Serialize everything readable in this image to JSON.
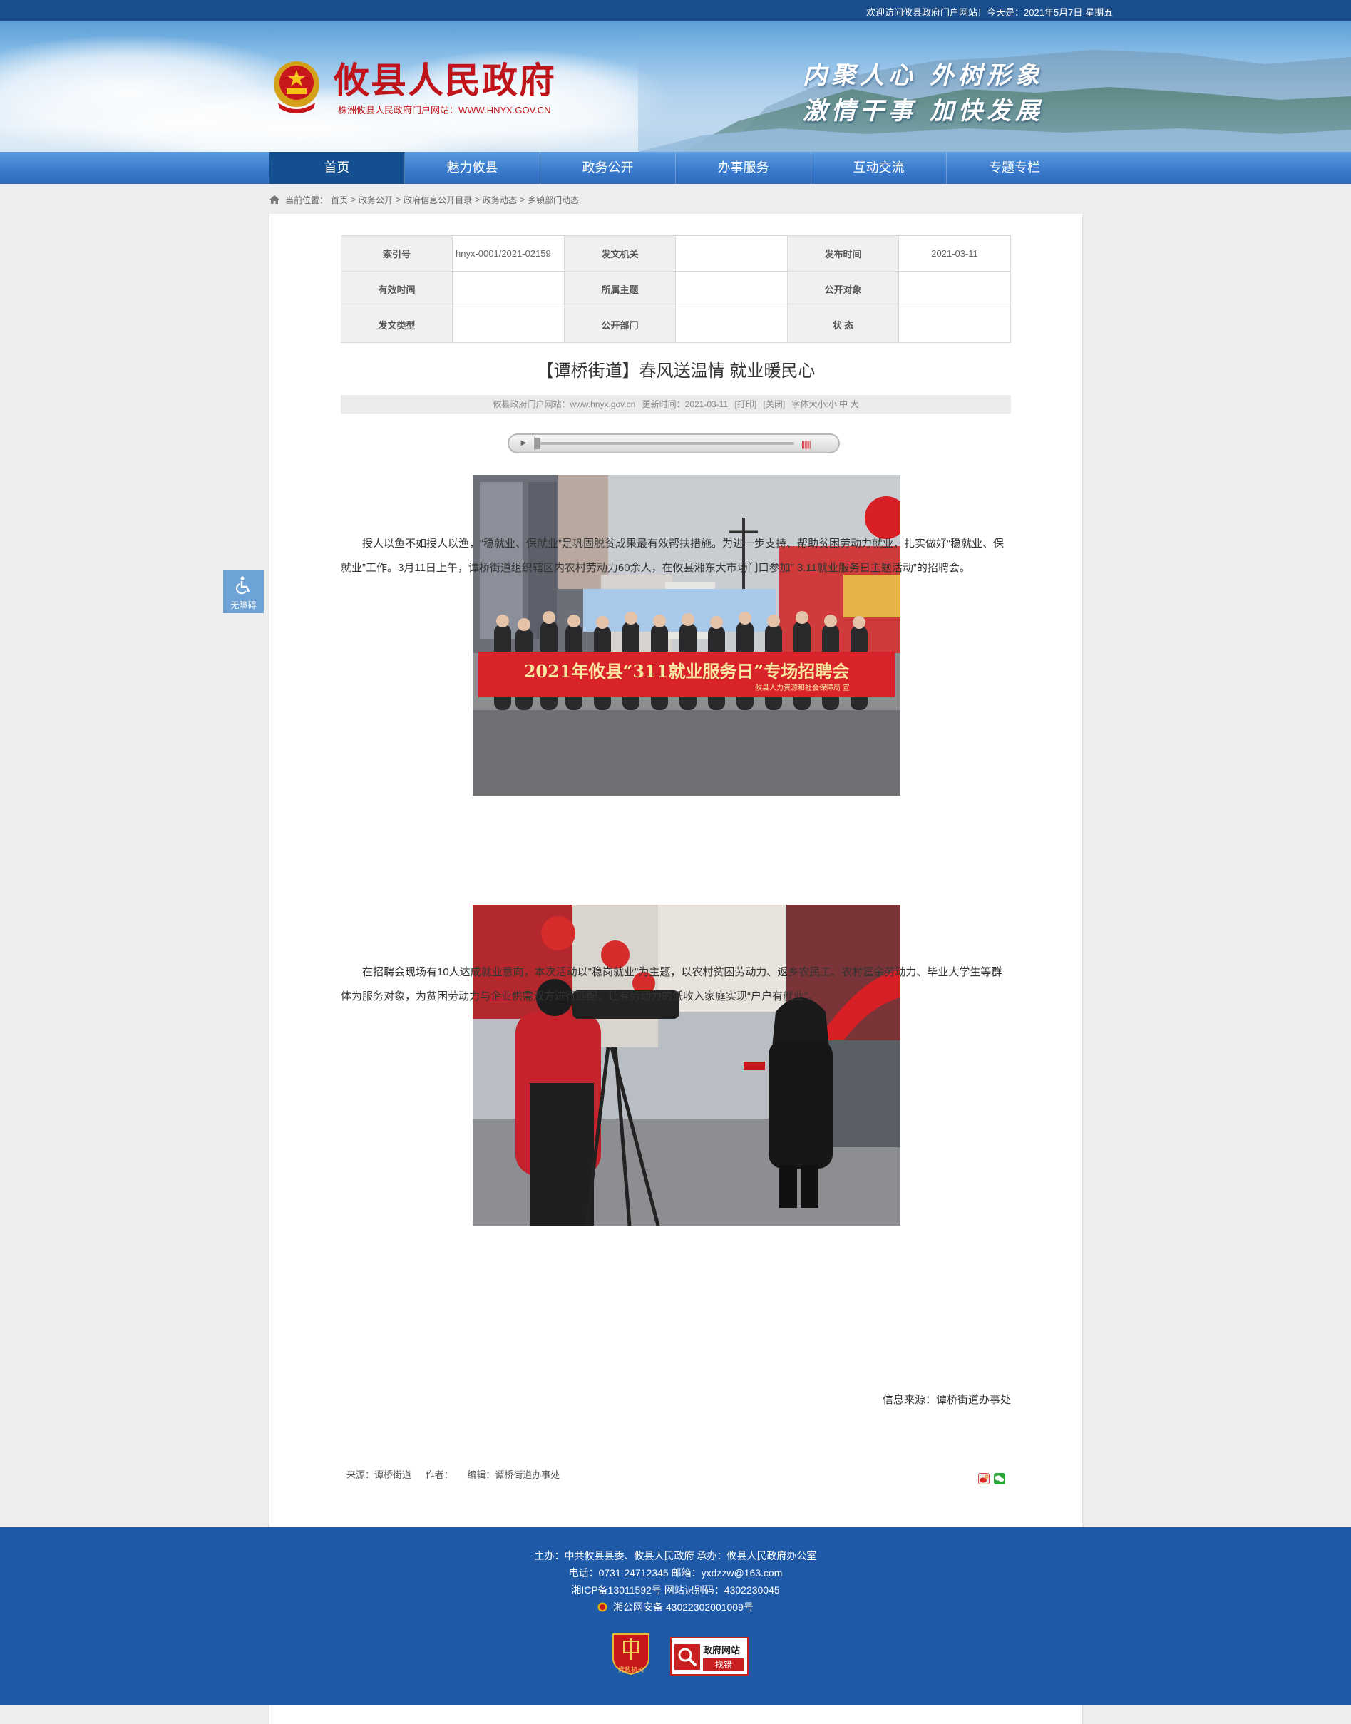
{
  "topbar": {
    "welcome": "欢迎访问攸县政府门户网站！今天是：2021年5月7日 星期五"
  },
  "header": {
    "site_name": "攸县人民政府",
    "site_subtitle": "株洲攸县人民政府门户网站：WWW.HNYX.GOV.CN",
    "slogan_line1": "内聚人心 外树形象",
    "slogan_line2": "激情干事 加快发展"
  },
  "nav": {
    "items": [
      {
        "label": "首页"
      },
      {
        "label": "魅力攸县"
      },
      {
        "label": "政务公开"
      },
      {
        "label": "办事服务"
      },
      {
        "label": "互动交流"
      },
      {
        "label": "专题专栏"
      }
    ]
  },
  "breadcrumb": {
    "prefix": "当前位置：",
    "items": [
      "首页",
      "政务公开",
      "政府信息公开目录",
      "政务动态",
      "乡镇部门动态"
    ],
    "separator": ">"
  },
  "info_table": {
    "index_label": "索引号",
    "index_value": "hnyx-0001/2021-02159",
    "issuer_label": "发文机关",
    "issuer_value": "",
    "date_label": "发布时间",
    "date_value": "2021-03-11",
    "valid_label": "有效时间",
    "valid_value": "",
    "topic_label": "所属主题",
    "topic_value": "",
    "audience_label": "公开对象",
    "audience_value": "",
    "doctype_label": "发文类型",
    "doctype_value": "",
    "dept_label": "公开部门",
    "dept_value": "",
    "status_label": "状 态",
    "status_value": ""
  },
  "article": {
    "title": "【谭桥街道】春风送温情 就业暖民心",
    "meta_site": "攸县政府门户网站：www.hnyx.gov.cn",
    "meta_updated": "更新时间：2021-03-11",
    "meta_print": "[打印]",
    "meta_close": "[关闭]",
    "meta_fontsize": "字体大小:小 中 大",
    "player_volume": "||||||",
    "photo1_banner": "2021年攸县“311就业服务日”专场招聘会",
    "photo1_sign": "攸县人力资源和社会保障局 宣",
    "para1": "授人以鱼不如授人以渔，“稳就业、保就业”是巩固脱贫成果最有效帮扶措施。为进一步支持、帮助贫困劳动力就业，扎实做好“稳就业、保就业”工作。3月11日上午，谭桥街道组织辖区内农村劳动力60余人，在攸县湘东大市场门口参加” 3.11就业服务日主题活动”的招聘会。",
    "para2": "在招聘会现场有10人达成就业意向，本次活动以\"稳岗就业\"为主题，以农村贫困劳动力、返乡农民工、农村富余劳动力、毕业大学生等群体为服务对象，为贫困劳动力与企业供需双方进行匹配，让有劳动力的低收入家庭实现“户户有就业”。",
    "source_line": "信息来源：谭桥街道办事处",
    "footer_source": "来源：谭桥街道",
    "footer_author": "作者：",
    "footer_editor": "编辑：谭桥街道办事处"
  },
  "accessibility": {
    "label": "无障碍"
  },
  "footer": {
    "line1": "主办：中共攸县县委、攸县人民政府 承办：攸县人民政府办公室",
    "line2": "电话：0731-24712345 邮箱：yxdzzw@163.com",
    "line3": "湘ICP备13011592号   网站识别码：4302230045",
    "line4": "湘公网安备 43022302001009号",
    "badge1": "党政机关",
    "badge2_top": "政府网站",
    "badge2_bottom": "找错"
  },
  "colors": {
    "brand_blue": "#1f5aa8",
    "nav_active": "#14508f",
    "title_red": "#c0141b"
  }
}
